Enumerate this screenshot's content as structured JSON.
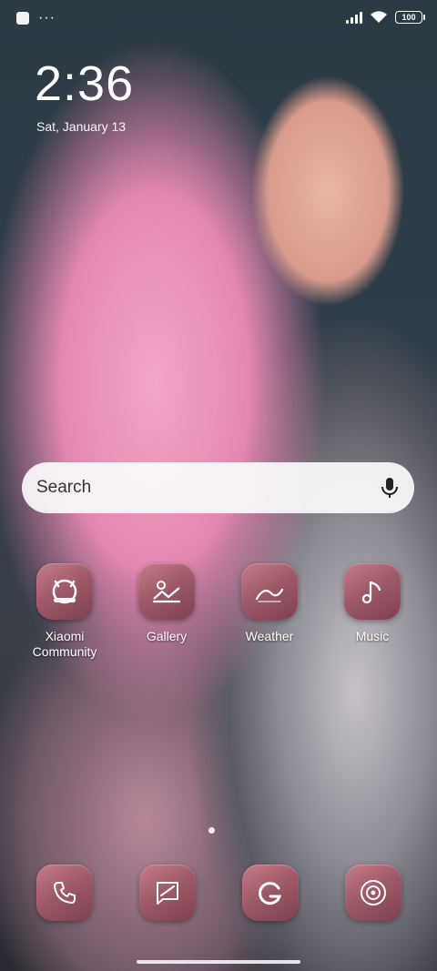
{
  "status_bar": {
    "battery_level": "100",
    "overflow_dots": "···"
  },
  "lock": {
    "time": "2:36",
    "date": "Sat, January 13"
  },
  "search": {
    "placeholder": "Search"
  },
  "apps": [
    {
      "label": "Xiaomi\nCommunity",
      "icon": "xiaomi-community-icon"
    },
    {
      "label": "Gallery",
      "icon": "gallery-icon"
    },
    {
      "label": "Weather",
      "icon": "weather-icon"
    },
    {
      "label": "Music",
      "icon": "music-icon"
    }
  ],
  "dock": [
    {
      "icon": "phone-icon"
    },
    {
      "icon": "messages-icon"
    },
    {
      "icon": "google-icon"
    },
    {
      "icon": "camera-icon"
    }
  ],
  "colors": {
    "icon_tint": "#9c5866",
    "search_bg": "#fafafa"
  }
}
